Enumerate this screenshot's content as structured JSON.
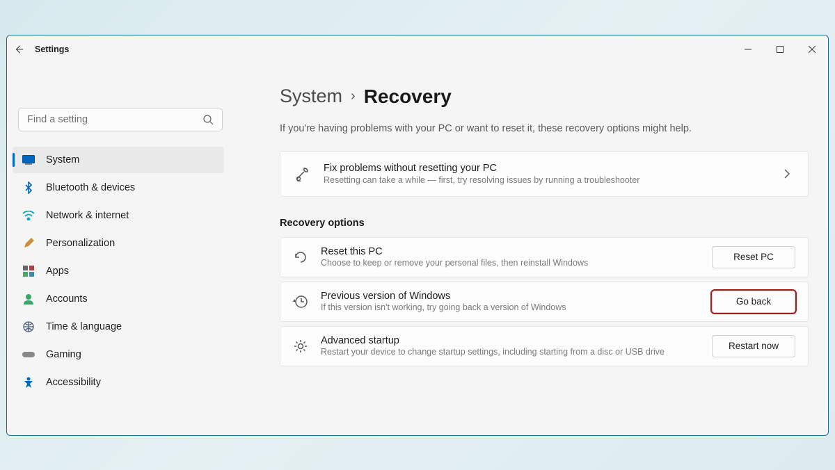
{
  "titlebar": {
    "title": "Settings"
  },
  "search": {
    "placeholder": "Find a setting"
  },
  "sidebar": {
    "items": [
      {
        "label": "System",
        "active": true
      },
      {
        "label": "Bluetooth & devices"
      },
      {
        "label": "Network & internet"
      },
      {
        "label": "Personalization"
      },
      {
        "label": "Apps"
      },
      {
        "label": "Accounts"
      },
      {
        "label": "Time & language"
      },
      {
        "label": "Gaming"
      },
      {
        "label": "Accessibility"
      }
    ]
  },
  "breadcrumb": {
    "parent": "System",
    "current": "Recovery"
  },
  "note": "If you're having problems with your PC or want to reset it, these recovery options might help.",
  "fixCard": {
    "title": "Fix problems without resetting your PC",
    "desc": "Resetting can take a while — first, try resolving issues by running a troubleshooter"
  },
  "recoverySection": {
    "heading": "Recovery options"
  },
  "options": {
    "reset": {
      "title": "Reset this PC",
      "desc": "Choose to keep or remove your personal files, then reinstall Windows",
      "button": "Reset PC"
    },
    "previous": {
      "title": "Previous version of Windows",
      "desc": "If this version isn't working, try going back a version of Windows",
      "button": "Go back"
    },
    "advanced": {
      "title": "Advanced startup",
      "desc": "Restart your device to change startup settings, including starting from a disc or USB drive",
      "button": "Restart now"
    }
  }
}
